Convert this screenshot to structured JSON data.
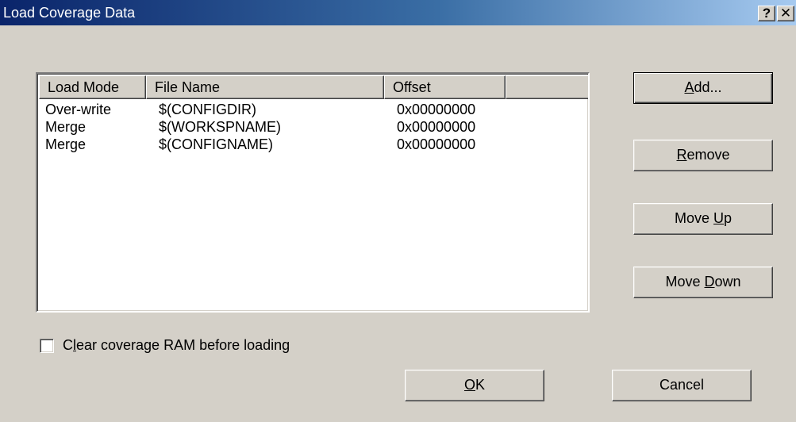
{
  "window": {
    "title": "Load Coverage Data",
    "help_label": "?",
    "close_label": "✕"
  },
  "list": {
    "columns": [
      "Load Mode",
      "File Name",
      "Offset",
      ""
    ],
    "rows": [
      {
        "mode": "Over-write",
        "file": "$(CONFIGDIR)",
        "offset": "0x00000000"
      },
      {
        "mode": "Merge",
        "file": "$(WORKSPNAME)",
        "offset": "0x00000000"
      },
      {
        "mode": "Merge",
        "file": "$(CONFIGNAME)",
        "offset": "0x00000000"
      }
    ]
  },
  "buttons": {
    "add": {
      "pre": "",
      "key": "A",
      "post": "dd..."
    },
    "remove": {
      "pre": "",
      "key": "R",
      "post": "emove"
    },
    "move_up": {
      "pre": "Move ",
      "key": "U",
      "post": "p"
    },
    "move_down": {
      "pre": "Move ",
      "key": "D",
      "post": "own"
    },
    "ok": {
      "pre": "",
      "key": "O",
      "post": "K"
    },
    "cancel": {
      "pre": "Cancel",
      "key": "",
      "post": ""
    }
  },
  "options": {
    "clear_ram": {
      "pre": "C",
      "key": "l",
      "post": "ear coverage RAM before loading",
      "checked": false
    }
  }
}
